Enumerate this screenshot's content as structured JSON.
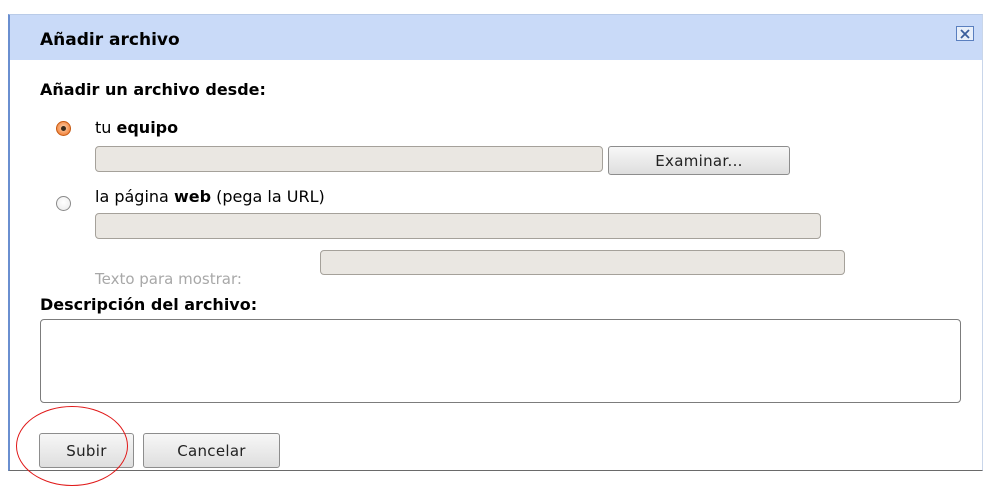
{
  "dialog": {
    "title": "Añadir archivo",
    "close_icon": "close-x-icon",
    "source_label": "Añadir un archivo desde:",
    "option_computer": {
      "prefix": "tu ",
      "bold": "equipo",
      "selected": true,
      "file_value": "",
      "browse_label": "Examinar..."
    },
    "option_web": {
      "prefix": "la página ",
      "bold": "web",
      "suffix": " (pega la URL)",
      "selected": false,
      "url_value": "",
      "display_text_label": "Texto para mostrar:",
      "display_text_value": ""
    },
    "description_label": "Descripción del archivo:",
    "description_value": "",
    "submit_label": "Subir",
    "cancel_label": "Cancelar"
  },
  "colors": {
    "titlebar_bg": "#c9daf8",
    "accent_border": "#6a8fd0",
    "radio_selected": "#f38a46",
    "annotation_circle": "#e01818",
    "input_bg": "#eae7e2"
  }
}
